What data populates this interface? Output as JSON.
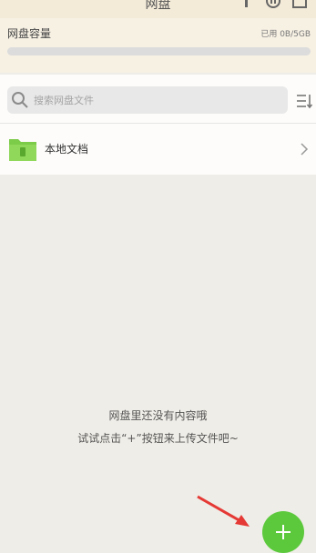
{
  "header": {
    "title": "网盘"
  },
  "capacity": {
    "label": "网盘容量",
    "used_text": "已用 0B/5GB",
    "used_fraction": 0
  },
  "search": {
    "placeholder": "搜索网盘文件"
  },
  "folder_row": {
    "name": "本地文档"
  },
  "empty_state": {
    "line1": "网盘里还没有内容哦",
    "line2": "试试点击“+”按钮来上传文件吧~"
  },
  "colors": {
    "accent": "#5cc93d",
    "header_bg": "#f3ead8",
    "annotation_arrow": "#e53935"
  },
  "icons": [
    "info-icon",
    "transfer-icon",
    "upload-icon",
    "search-icon",
    "sort-icon",
    "folder-icon",
    "chevron-right-icon",
    "plus-icon"
  ]
}
